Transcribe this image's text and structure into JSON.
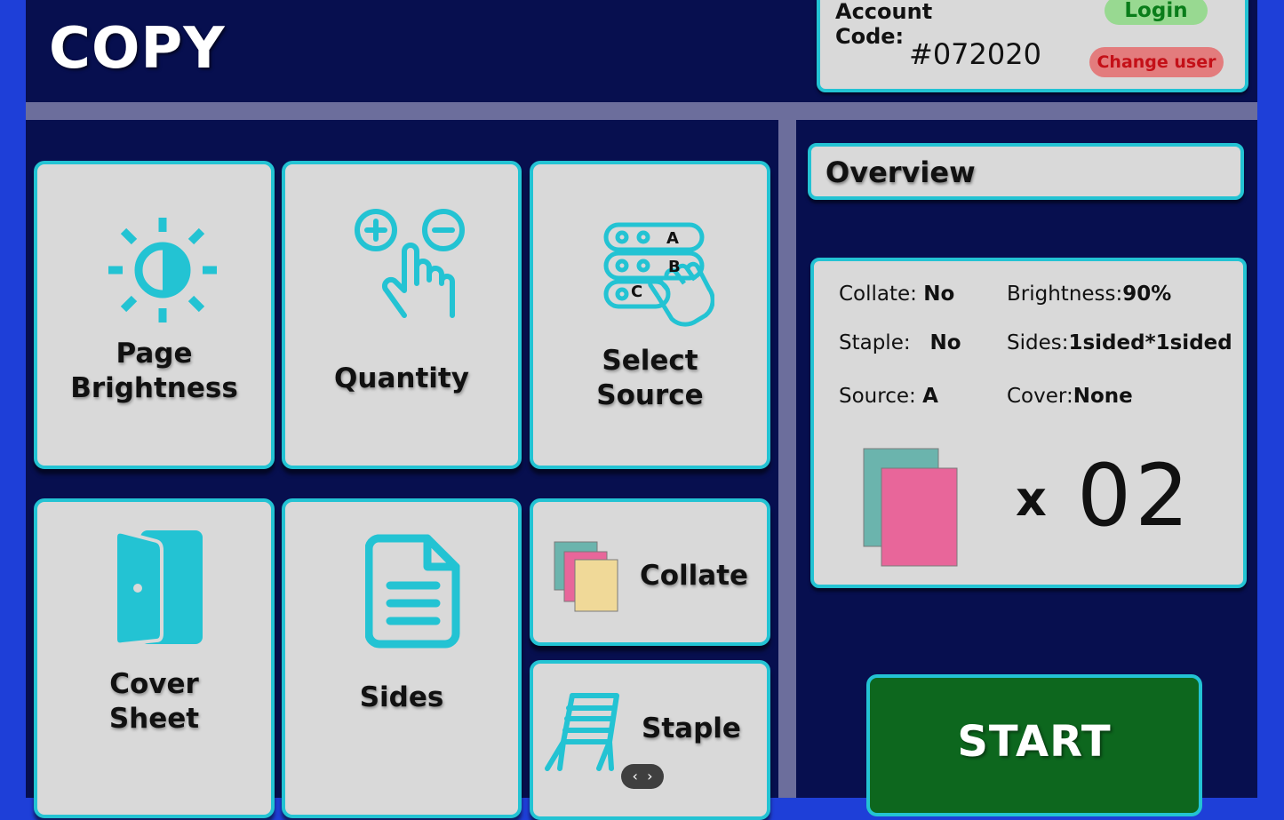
{
  "header": {
    "title": "COPY"
  },
  "account": {
    "label_line1": "Account",
    "label_line2": "Code:",
    "code": "#072020",
    "login_label": "Login",
    "change_user_label": "Change user"
  },
  "tiles": {
    "brightness": {
      "line1": "Page",
      "line2": "Brightness"
    },
    "quantity": {
      "label": "Quantity"
    },
    "source": {
      "line1": "Select",
      "line2": "Source",
      "options": [
        "A",
        "B",
        "C"
      ]
    },
    "cover": {
      "line1": "Cover",
      "line2": "Sheet"
    },
    "sides": {
      "label": "Sides"
    },
    "collate": {
      "label": "Collate"
    },
    "staple": {
      "label": "Staple"
    }
  },
  "overview": {
    "title": "Overview",
    "collate_label": "Collate:",
    "collate_value": "No",
    "brightness_label": "Brightness:",
    "brightness_value": "90%",
    "staple_label": "Staple:",
    "staple_value": "No",
    "sides_label": "Sides:",
    "sides_value": "1sided*1sided",
    "source_label": "Source:",
    "source_value": "A",
    "cover_label": "Cover:",
    "cover_value": "None",
    "times": "x",
    "count": "02"
  },
  "start": {
    "label": "START"
  },
  "pager": {
    "prev": "‹",
    "next": "›"
  },
  "colors": {
    "accent": "#23c3d3",
    "background": "#070f4f",
    "frame": "#1e3fd8",
    "start": "#0d671e",
    "login": "#98d991",
    "change_user": "#e37c7d"
  }
}
